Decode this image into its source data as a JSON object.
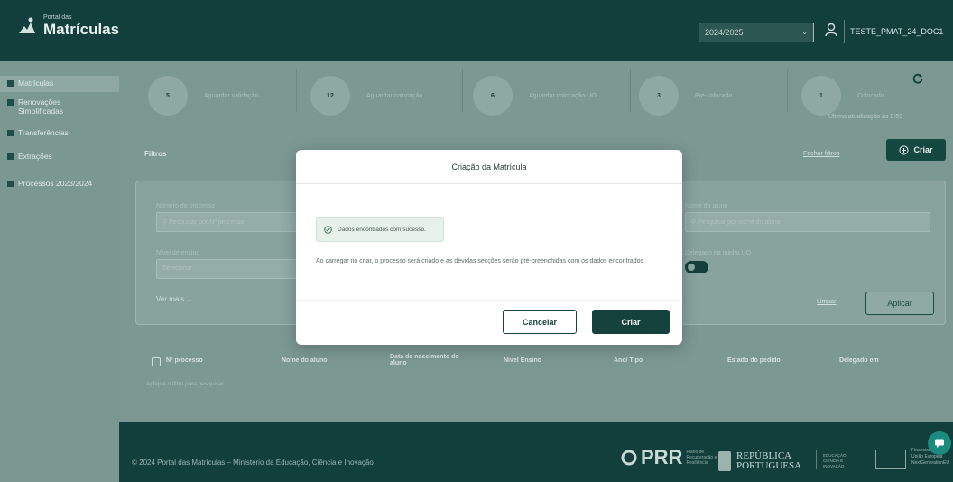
{
  "header": {
    "logo_small": "Portal das",
    "logo_big": "Matrículas",
    "year_select": "2024/2025",
    "user_name": "TESTE_PMAT_24_DOC1"
  },
  "sidebar": {
    "items": [
      {
        "label": "Matrículas",
        "icon": "grid-icon"
      },
      {
        "label": "Renovações Simplificadas",
        "icon": "grid-icon"
      },
      {
        "label": "Transferências",
        "icon": "transfer-icon"
      },
      {
        "label": "Extrações",
        "icon": "filter-icon"
      },
      {
        "label": "Processos 2023/2024",
        "icon": "folder-icon"
      }
    ]
  },
  "statuses": [
    {
      "count": "5",
      "label": "Aguardar validação"
    },
    {
      "count": "12",
      "label": "Aguardar colocação"
    },
    {
      "count": "6",
      "label": "Aguardar colocação UO"
    },
    {
      "count": "3",
      "label": "Pré-colocado"
    },
    {
      "count": "1",
      "label": "Colocado"
    }
  ],
  "updated_text": "Última atualização às 0:59",
  "filters": {
    "title": "Filtros",
    "close_link": "Fechar filtros",
    "create_button": "Criar",
    "process_number_label": "Número do processo",
    "process_number_placeholder": "Pesquisar por Nº processo",
    "student_name_label": "Nome do aluno",
    "student_name_placeholder": "Pesquisar por nome do aluno",
    "level_label": "Nível de ensino",
    "level_placeholder": "Selecionar",
    "delegated_label": "Delegado na minha UO",
    "see_more": "Ver mais",
    "clear_link": "Limpar",
    "apply_button": "Aplicar"
  },
  "table": {
    "headers": [
      "Nº processo",
      "Nome do aluno",
      "Data de nascimento do aluno",
      "Nível Ensino",
      "Ano/ Tipo",
      "Estado do pedido",
      "Delegado em"
    ],
    "empty_hint": "Aplique o filtro para pesquisar"
  },
  "footer": {
    "copyright": "© 2024 Portal das Matrículas – Ministério da Educação, Ciência e Inovação",
    "prr": "PRR",
    "prr_sub": "Plano de Recuperação e Resiliência",
    "republica_line1": "REPÚBLICA",
    "republica_line2": "PORTUGUESA",
    "ministry_mini": "EDUCAÇÃO, CIÊNCIA E INOVAÇÃO",
    "eu_text": "Financiado pela União Europeia NextGenerationEU"
  },
  "modal": {
    "title": "Criação da Matrícula",
    "success_message": "Dados encontrados com sucesso.",
    "body_text": "Ao carregar no criar, o processo será criado e as devidas secções serão pré-preenchidas com os dados encontrados.",
    "cancel_button": "Cancelar",
    "create_button": "Criar"
  },
  "colors": {
    "primary": "#16423d",
    "success_bg": "#e6f1ea",
    "chat_button": "#1b8a7f"
  }
}
